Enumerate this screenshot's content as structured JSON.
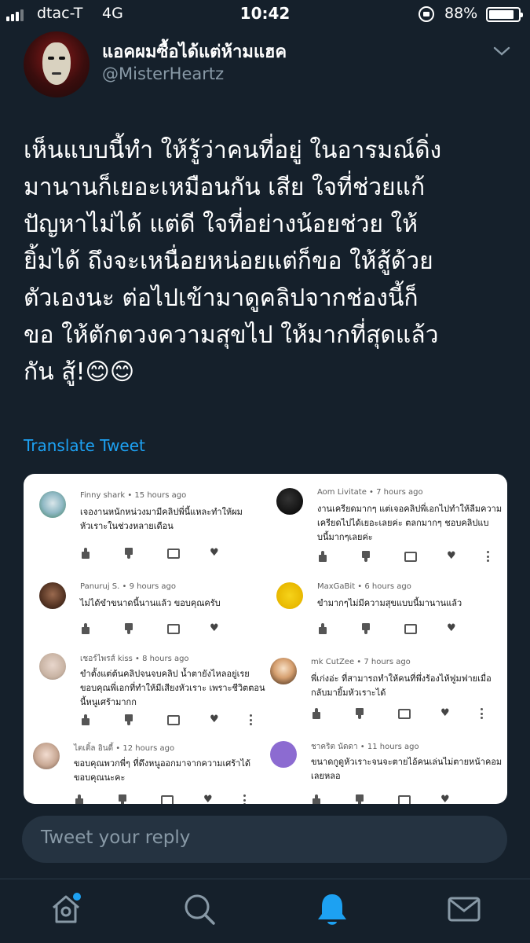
{
  "status_bar": {
    "carrier": "dtac-T",
    "network": "4G",
    "time": "10:42",
    "battery_percent": "88%",
    "battery_level": 0.88
  },
  "tweet": {
    "display_name": "แอคผมซื้อได้แต่ห้ามแฮค",
    "handle": "@MisterHeartz",
    "text": "เห็นแบบนี้ทำ ให้รู้ว่าคนที่อยู่ ในอารมณ์ดิ่ง\nมานานก็เยอะเหมือนกัน เสีย ใจที่ช่วยแก้\nปัญหาไม่ได้ แต่ดี ใจที่อย่างน้อยช่วย ให้\nยิ้มได้ ถึงจะเหนื่อยหน่อยแต่ก็ขอ ให้สู้ด้วย\nตัวเองนะ ต่อไปเข้ามาดูคลิปจากช่องนี้ก็\nขอ ให้ตักตวงความสุขไป ให้มากที่สุดแล้ว\nกัน สู้!😊😊",
    "translate_label": "Translate Tweet"
  },
  "embedded_comments": [
    {
      "author": "Finny shark",
      "time": "15 hours ago",
      "text": "เจองานหนักหน่วงมามีคลิปพี่นี้แหละทำให้ผม\nหัวเราะในช่วงหลายเดือน"
    },
    {
      "author": "Aom Livitate",
      "time": "7 hours ago",
      "text": "งานเครียดมากๆ แต่เจอคลิปพี่เอกไปทำให้ลืมความ\nเครียดไปได้เยอะเลยค่ะ ตลกมากๆ ชอบคลิปแบ\nบนี้มากๆเลยค่ะ"
    },
    {
      "author": "Panuruj S.",
      "time": "9 hours ago",
      "text": "ไม่ได้ขำขนาดนี้นานแล้ว ขอบคุณครับ"
    },
    {
      "author": "MaxGaBit",
      "time": "6 hours ago",
      "text": "ขำมากๆไม่มีความสุขแบบนี้มานานแล้ว"
    },
    {
      "author": "เชอร์ไพรส์ kiss",
      "time": "8 hours ago",
      "text": "ขำตั้งแต่ต้นคลิปจนจบคลิป น้ำตายังไหลอยู่เรย\nขอบคุณพี่เอกที่ทำให้มีเสียงหัวเราะ เพราะชีวิตตอน\nนี้หนูเศร้ามากก"
    },
    {
      "author": "mk CutZee",
      "time": "7 hours ago",
      "text": "พี่เก่งอ่ะ ที่สามารถทำให้คนที่พึ่งร้องไห้ฟูมฟายเมื่อ\nกลับมายิ้มหัวเราะได้"
    },
    {
      "author": "ไตเติ้ล อินดี้",
      "time": "12 hours ago",
      "text": "ขอบคุณพวกพี่ๆ ที่ดึงหนูออกมาจากความเศร้าได้\nขอบคุณนะคะ"
    },
    {
      "author": "ชาคริต นัดดา",
      "time": "11 hours ago",
      "text": "ขนาดกูดูหัวเราะจนจะตายไอ้คนเล่นไม่ตายหน้าคอม\nเลยหลอ"
    }
  ],
  "reply_placeholder": "Tweet your reply",
  "icons": {
    "tabs": [
      "home-icon",
      "search-icon",
      "notifications-bell-icon",
      "messages-mail-icon"
    ]
  },
  "colors": {
    "background": "#15202b",
    "accent": "#1da1f2",
    "muted": "#8899a6"
  }
}
